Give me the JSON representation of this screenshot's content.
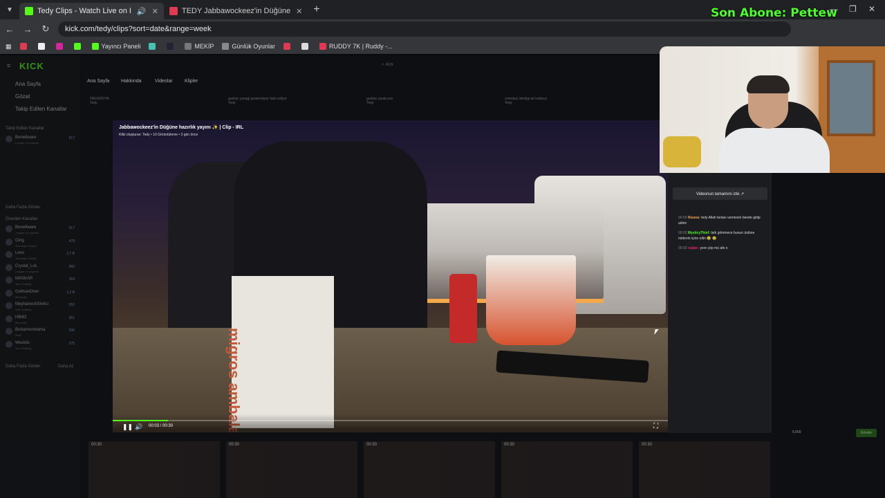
{
  "browser": {
    "tabs": [
      {
        "title": "Tedy Clips - Watch Live on I",
        "active": true,
        "icon_color": "#53fc18"
      },
      {
        "title": "TEDY Jabbawockeez'in Düğüne",
        "active": false,
        "icon_color": "#e03a52"
      }
    ],
    "new_tab": "+",
    "url": "kick.com/tedy/clips?sort=date&range=week",
    "bookmarks": [
      "Yayıncı Paneli",
      "MEKİP",
      "Günlük Oyunlar",
      "RUDDY 7K | Ruddy -..."
    ]
  },
  "overlay": {
    "abone": "Son Abone: Pettew"
  },
  "kick": {
    "logo": "KICK",
    "search_placeholder": "Ara",
    "sidebar": {
      "links": [
        "Ana Sayfa",
        "Gözat",
        "Takip Edilen Kanallar"
      ],
      "followed_head": "Takip Edilen Kanallar",
      "followed": [
        {
          "name": "Bone8ware",
          "sub": "League of Legends",
          "count": "517"
        }
      ],
      "more1": "Daha Fazla Göster",
      "recommended_head": "Önerilen Kanallar",
      "recommended": [
        {
          "name": "Bone8ware",
          "sub": "League of Legends",
          "count": "517"
        },
        {
          "name": "Ging",
          "sub": "Teamfight Tactics",
          "count": "479"
        },
        {
          "name": "Levo",
          "sub": "Teamfight Tactics",
          "count": "2,7 B"
        },
        {
          "name": "Crystal_LoL",
          "sub": "League of Legends",
          "count": "960"
        },
        {
          "name": "MASKAR",
          "sub": "Just Chatting",
          "count": "164"
        },
        {
          "name": "GokhanOner",
          "sub": "Minecraft",
          "count": "1,2 B"
        },
        {
          "name": "MeyhanecilSimitci",
          "sub": "Just Chatting",
          "count": "552"
        },
        {
          "name": "HBdO",
          "sub": "Minecraft",
          "count": "351"
        },
        {
          "name": "Bishamonntama",
          "sub": "Slots",
          "count": "296"
        },
        {
          "name": "Wecktis",
          "sub": "Just Chatting",
          "count": "275"
        }
      ],
      "more2": "Daha Fazla Göster",
      "less": "Daha Az"
    },
    "channel_nav": [
      "Ana Sayfa",
      "Hakkında",
      "Videolar",
      "Klipler"
    ],
    "top_clips": [
      {
        "title": "ORUSPUYA",
        "meta": "Tedy"
      },
      {
        "title": "gurkan yanagi gostermiyor farkı ediyor",
        "meta": "Tedy"
      },
      {
        "title": "gurkan yarak pov",
        "meta": "Tedy"
      },
      {
        "title": "orendayi sitedigi alt kokteyo",
        "meta": "Tedy"
      }
    ],
    "video": {
      "title": "Jabbawockeez'in Düğüne hazırlık yayını ✨ | Clip - IRL",
      "subtitle": "Klibi oluşturan: Tedy • 10 Görüntüleme • 3 gün önce",
      "time": "00:03 / 00:30",
      "progress": 0.1,
      "bag_text": "migros ambalaj"
    },
    "panel": {
      "watch_full": "Videonun tamamını izle ↗",
      "chat": [
        {
          "time": "00:00",
          "user": "Nizana:",
          "user_color": "#f0a14a",
          "msg": "tedy Allah belanı vermesin bende gidip aldım"
        },
        {
          "time": "00:02",
          "user": "MysticyThief:",
          "user_color": "#53fc18",
          "msg": "tatlı gömmece bunun üstüne midenin içine edin 😂 😂"
        },
        {
          "time": "00:02",
          "user": "najlan:",
          "user_color": "#e0245e",
          "msg": "yere çöp mü attı o"
        }
      ]
    },
    "bottom_clips": [
      "00:30",
      "00:30",
      "00:30",
      "00:30",
      "00:30"
    ],
    "send": "Gönder",
    "coins": "5.000"
  }
}
